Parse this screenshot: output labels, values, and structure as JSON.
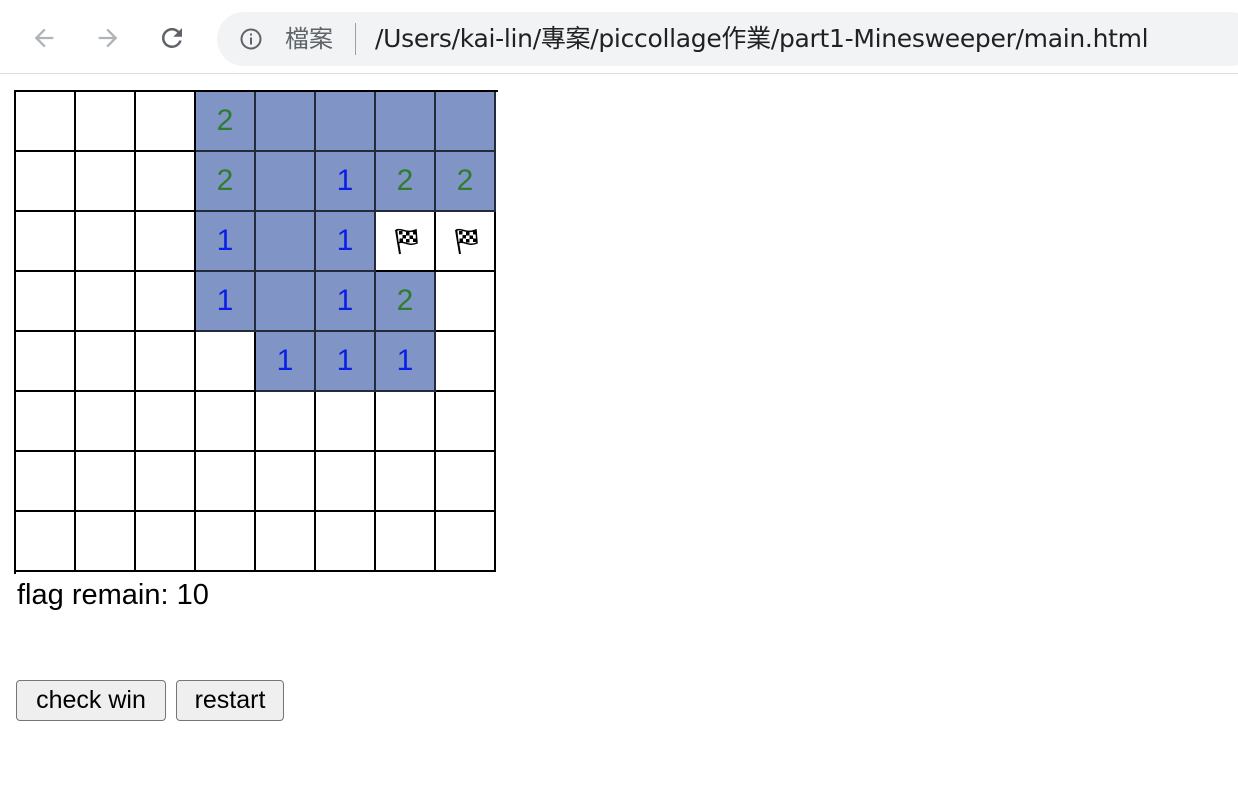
{
  "browser": {
    "file_label": "檔案",
    "url": "/Users/kai-lin/專案/piccollage作業/part1-Minesweeper/main.html"
  },
  "board": {
    "rows": 8,
    "cols": 8,
    "cells": [
      [
        "",
        "",
        "",
        "2",
        "O",
        "O",
        "O",
        "O"
      ],
      [
        "",
        "",
        "",
        "2",
        "O",
        "1",
        "2",
        "2"
      ],
      [
        "",
        "",
        "",
        "1",
        "O",
        "1",
        "F",
        "F"
      ],
      [
        "",
        "",
        "",
        "1",
        "O",
        "1",
        "2",
        ""
      ],
      [
        "",
        "",
        "",
        "",
        "1",
        "1",
        "1",
        ""
      ],
      [
        "",
        "",
        "",
        "",
        "",
        "",
        "",
        ""
      ],
      [
        "",
        "",
        "",
        "",
        "",
        "",
        "",
        ""
      ],
      [
        "",
        "",
        "",
        "",
        "",
        "",
        "",
        ""
      ]
    ],
    "legend": {
      "": "hidden",
      "O": "revealed-empty",
      "F": "flag",
      "1-8": "revealed-number"
    },
    "colors": {
      "revealed": "#8194c6",
      "number_1": "#0a1fe6",
      "number_2": "#2e7d2c"
    }
  },
  "status": {
    "flag_remain": "flag remain: 10"
  },
  "controls": {
    "check_win_label": "check win",
    "restart_label": "restart"
  },
  "icons": [
    "back-arrow-icon",
    "forward-arrow-icon",
    "reload-icon",
    "info-icon",
    "checkered-flag-icon"
  ]
}
